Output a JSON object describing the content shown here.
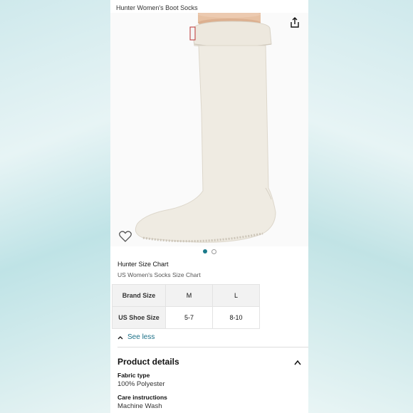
{
  "header": {
    "title": "Hunter Women's Boot Socks"
  },
  "gallery": {
    "total_images": 2,
    "active_index": 0
  },
  "size_chart": {
    "title": "Hunter Size Chart",
    "subtitle": "US Women's Socks Size Chart",
    "row_headers": [
      "Brand Size",
      "US Shoe Size"
    ],
    "columns": [
      {
        "brand": "M",
        "us": "5-7"
      },
      {
        "brand": "L",
        "us": "8-10"
      }
    ],
    "toggle_label": "See less"
  },
  "product_details": {
    "title": "Product details",
    "items": [
      {
        "label": "Fabric type",
        "value": "100% Polyester"
      },
      {
        "label": "Care instructions",
        "value": "Machine Wash"
      }
    ]
  },
  "colors": {
    "accent": "#1a7a8a",
    "link": "#1a6f86"
  }
}
